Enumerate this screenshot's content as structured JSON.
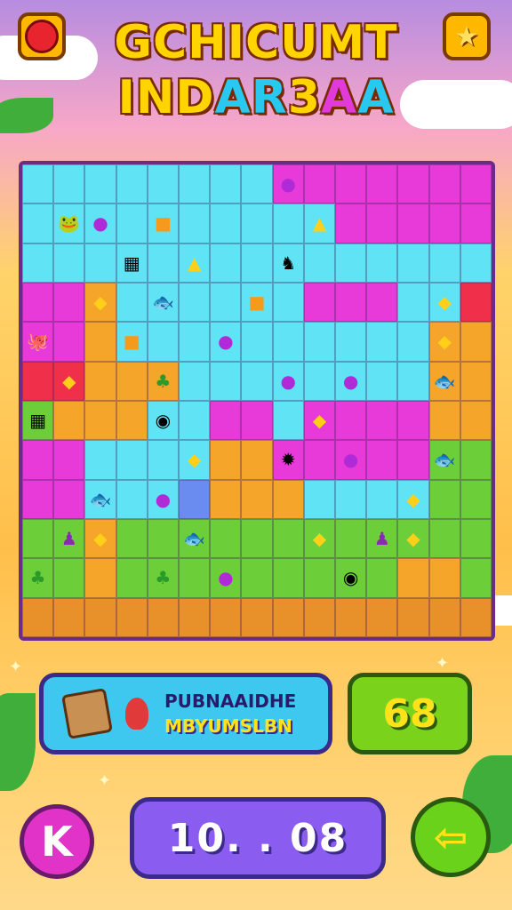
{
  "title": {
    "line1": "GCHICUMT",
    "line2_parts": [
      "IND",
      "AR",
      "3",
      "A",
      "A"
    ]
  },
  "colors": {
    "line2_part_colors": [
      "#ffd400",
      "#28c8f0",
      "#ffd400",
      "#e23ad8",
      "#28c8f0"
    ]
  },
  "top_buttons": {
    "left_icon": "red-gem-icon",
    "right_icon": "star-icon"
  },
  "info_panel": {
    "icons": [
      "treasure-map-icon",
      "flame-icon"
    ],
    "line1": "PUBNAAIDHE",
    "line2": "MBYUMSLBN"
  },
  "score": "68",
  "timer": "10. . 08",
  "bottom_left_button": "K",
  "bottom_right_button": "⇦"
}
